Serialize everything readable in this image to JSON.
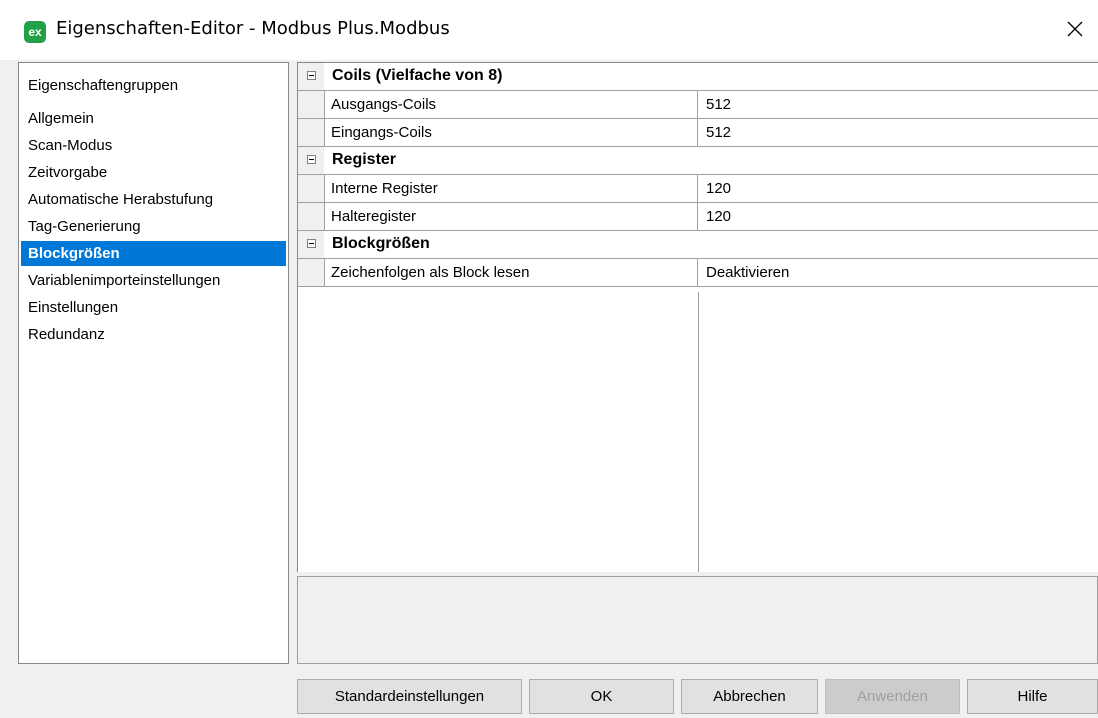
{
  "window": {
    "title": "Eigenschaften-Editor - Modbus Plus.Modbus",
    "app_icon_text": "ex",
    "close_glyph": "✕"
  },
  "sidebar": {
    "header": "Eigenschaftengruppen",
    "items": [
      {
        "label": "Allgemein",
        "selected": false
      },
      {
        "label": "Scan-Modus",
        "selected": false
      },
      {
        "label": "Zeitvorgabe",
        "selected": false
      },
      {
        "label": "Automatische Herabstufung",
        "selected": false
      },
      {
        "label": "Tag-Generierung",
        "selected": false
      },
      {
        "label": "Blockgrößen",
        "selected": true
      },
      {
        "label": "Variablenimporteinstellungen",
        "selected": false
      },
      {
        "label": "Einstellungen",
        "selected": false
      },
      {
        "label": "Redundanz",
        "selected": false
      }
    ]
  },
  "grid": {
    "categories": [
      {
        "label": "Coils (Vielfache von 8)",
        "properties": [
          {
            "name": "Ausgangs-Coils",
            "value": "512"
          },
          {
            "name": "Eingangs-Coils",
            "value": "512"
          }
        ]
      },
      {
        "label": "Register",
        "properties": [
          {
            "name": "Interne Register",
            "value": "120"
          },
          {
            "name": "Halteregister",
            "value": "120"
          }
        ]
      },
      {
        "label": "Blockgrößen",
        "properties": [
          {
            "name": "Zeichenfolgen als Block lesen",
            "value": "Deaktivieren"
          }
        ]
      }
    ]
  },
  "buttons": {
    "defaults": "Standardeinstellungen",
    "ok": "OK",
    "cancel": "Abbrechen",
    "apply": "Anwenden",
    "help": "Hilfe"
  },
  "colors": {
    "selection": "#0078d7",
    "app_icon": "#22a047"
  }
}
